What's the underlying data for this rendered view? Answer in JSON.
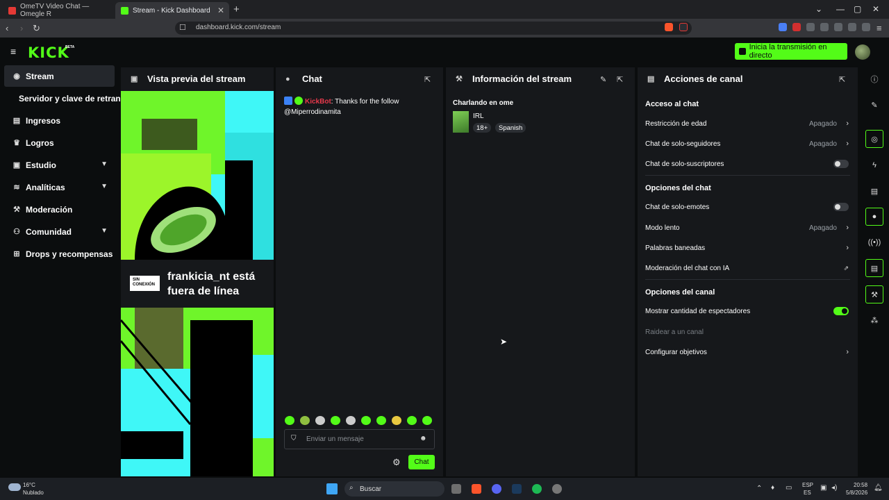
{
  "browser": {
    "tabs": [
      {
        "title": "OmeTV Video Chat — Omegle R",
        "active": false
      },
      {
        "title": "Stream - Kick Dashboard",
        "active": true
      }
    ],
    "url": "dashboard.kick.com/stream"
  },
  "header": {
    "logo": "KICK",
    "beta": "BETA",
    "go_live": "Inicia la transmisión en directo"
  },
  "sidebar": {
    "items": [
      {
        "label": "Stream",
        "icon": "stream-icon",
        "active": true
      },
      {
        "label": "Servidor y clave de retransn",
        "icon": "",
        "active": false
      },
      {
        "label": "Ingresos",
        "icon": "revenue-icon"
      },
      {
        "label": "Logros",
        "icon": "trophy-icon"
      },
      {
        "label": "Estudio",
        "icon": "studio-icon",
        "expandable": true
      },
      {
        "label": "Analíticas",
        "icon": "analytics-icon",
        "expandable": true
      },
      {
        "label": "Moderación",
        "icon": "wrench-icon"
      },
      {
        "label": "Comunidad",
        "icon": "community-icon",
        "expandable": true
      },
      {
        "label": "Drops y recompensas",
        "icon": "drops-icon"
      }
    ]
  },
  "preview": {
    "title": "Vista previa del stream",
    "offline_badge": "SIN CONEXIÓN",
    "offline_text": "frankicia_nt está fuera de línea"
  },
  "chat": {
    "title": "Chat",
    "message": {
      "user": "KickBot",
      "text": ": Thanks for the follow @Miperrodinamita"
    },
    "input_placeholder": "Enviar un mensaje",
    "send_label": "Chat"
  },
  "stream_info": {
    "title": "Información del stream",
    "category_label": "Charlando en ome",
    "category": "IRL",
    "tags": [
      "18+",
      "Spanish"
    ]
  },
  "channel_actions": {
    "title": "Acciones de canal",
    "sections": [
      {
        "title": "Acceso al chat",
        "rows": [
          {
            "label": "Restricción de edad",
            "value": "Apagado",
            "control": "chevron"
          },
          {
            "label": "Chat de solo-seguidores",
            "value": "Apagado",
            "control": "chevron"
          },
          {
            "label": "Chat de solo-suscriptores",
            "value": "",
            "control": "toggle",
            "on": false
          }
        ]
      },
      {
        "title": "Opciones del chat",
        "rows": [
          {
            "label": "Chat de solo-emotes",
            "value": "",
            "control": "toggle",
            "on": false
          },
          {
            "label": "Modo lento",
            "value": "Apagado",
            "control": "chevron"
          },
          {
            "label": "Palabras baneadas",
            "value": "",
            "control": "chevron"
          },
          {
            "label": "Moderación del chat con IA",
            "value": "",
            "control": "external"
          }
        ]
      },
      {
        "title": "Opciones del canal",
        "rows": [
          {
            "label": "Mostrar cantidad de espectadores",
            "value": "",
            "control": "toggle",
            "on": true
          },
          {
            "label": "Raidear a un canal",
            "value": "",
            "control": "none",
            "disabled": true
          },
          {
            "label": "Configurar objetivos",
            "value": "",
            "control": "chevron"
          }
        ]
      }
    ]
  },
  "taskbar": {
    "weather_temp": "16°C",
    "weather_desc": "Nublado",
    "search": "Buscar",
    "lang": "ESP",
    "lang_sub": "ES",
    "time": "20:58",
    "date": "5/8/2026"
  },
  "colors": {
    "accent": "#53fc18",
    "bg": "#0b0d0e",
    "panel": "#16181b",
    "kickbot": "#e8394b"
  }
}
